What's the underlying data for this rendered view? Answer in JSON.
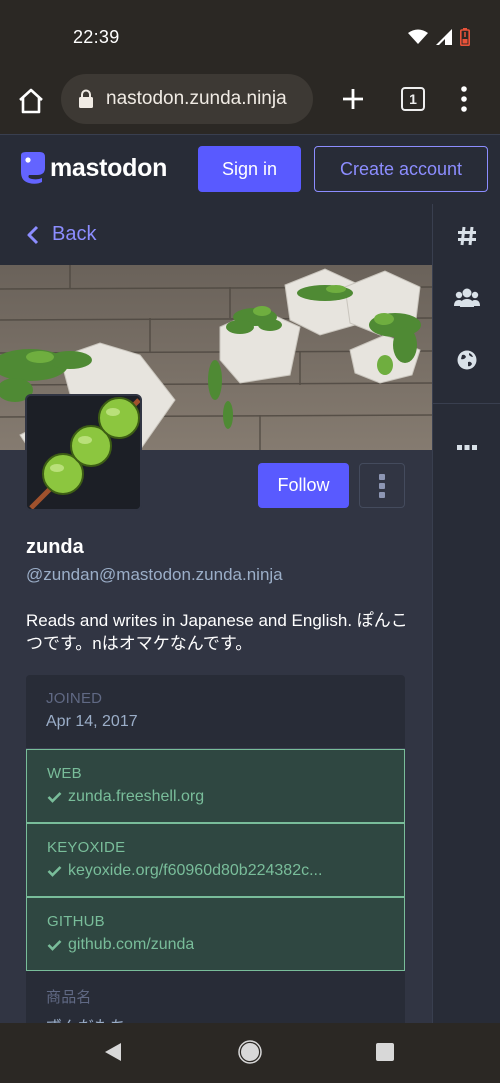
{
  "status_bar": {
    "time": "22:39"
  },
  "browser": {
    "url": "nastodon.zunda.ninja",
    "tab_count": "1"
  },
  "header": {
    "logo_text": "mastodon",
    "sign_in_label": "Sign in",
    "create_account_label": "Create account"
  },
  "back_bar": {
    "back_label": "Back"
  },
  "profile": {
    "display_name": "zunda",
    "handle": "@zundan@mastodon.zunda.ninja",
    "bio": "Reads and writes in Japanese and English. ぽんこつです。nはオマケなんです。",
    "follow_label": "Follow",
    "fields": [
      {
        "name": "JOINED",
        "value": "Apr 14, 2017",
        "verified": false
      },
      {
        "name": "WEB",
        "value": "zunda.freeshell.org",
        "verified": true
      },
      {
        "name": "KEYOXIDE",
        "value": "keyoxide.org/f60960d80b224382c...",
        "verified": true
      },
      {
        "name": "GITHUB",
        "value": "github.com/zunda",
        "verified": true
      },
      {
        "name": "商品名",
        "value": "ずんだもち",
        "verified": false
      }
    ]
  },
  "sidenav": {
    "items": [
      {
        "icon": "hashtag-icon"
      },
      {
        "icon": "users-icon"
      },
      {
        "icon": "globe-icon"
      },
      {
        "icon": "ellipsis-icon"
      }
    ]
  },
  "colors": {
    "accent": "#595aff",
    "accent_light": "#8c8dff",
    "verified": "#79bd9a",
    "background": "#282c37",
    "column": "#313543"
  }
}
